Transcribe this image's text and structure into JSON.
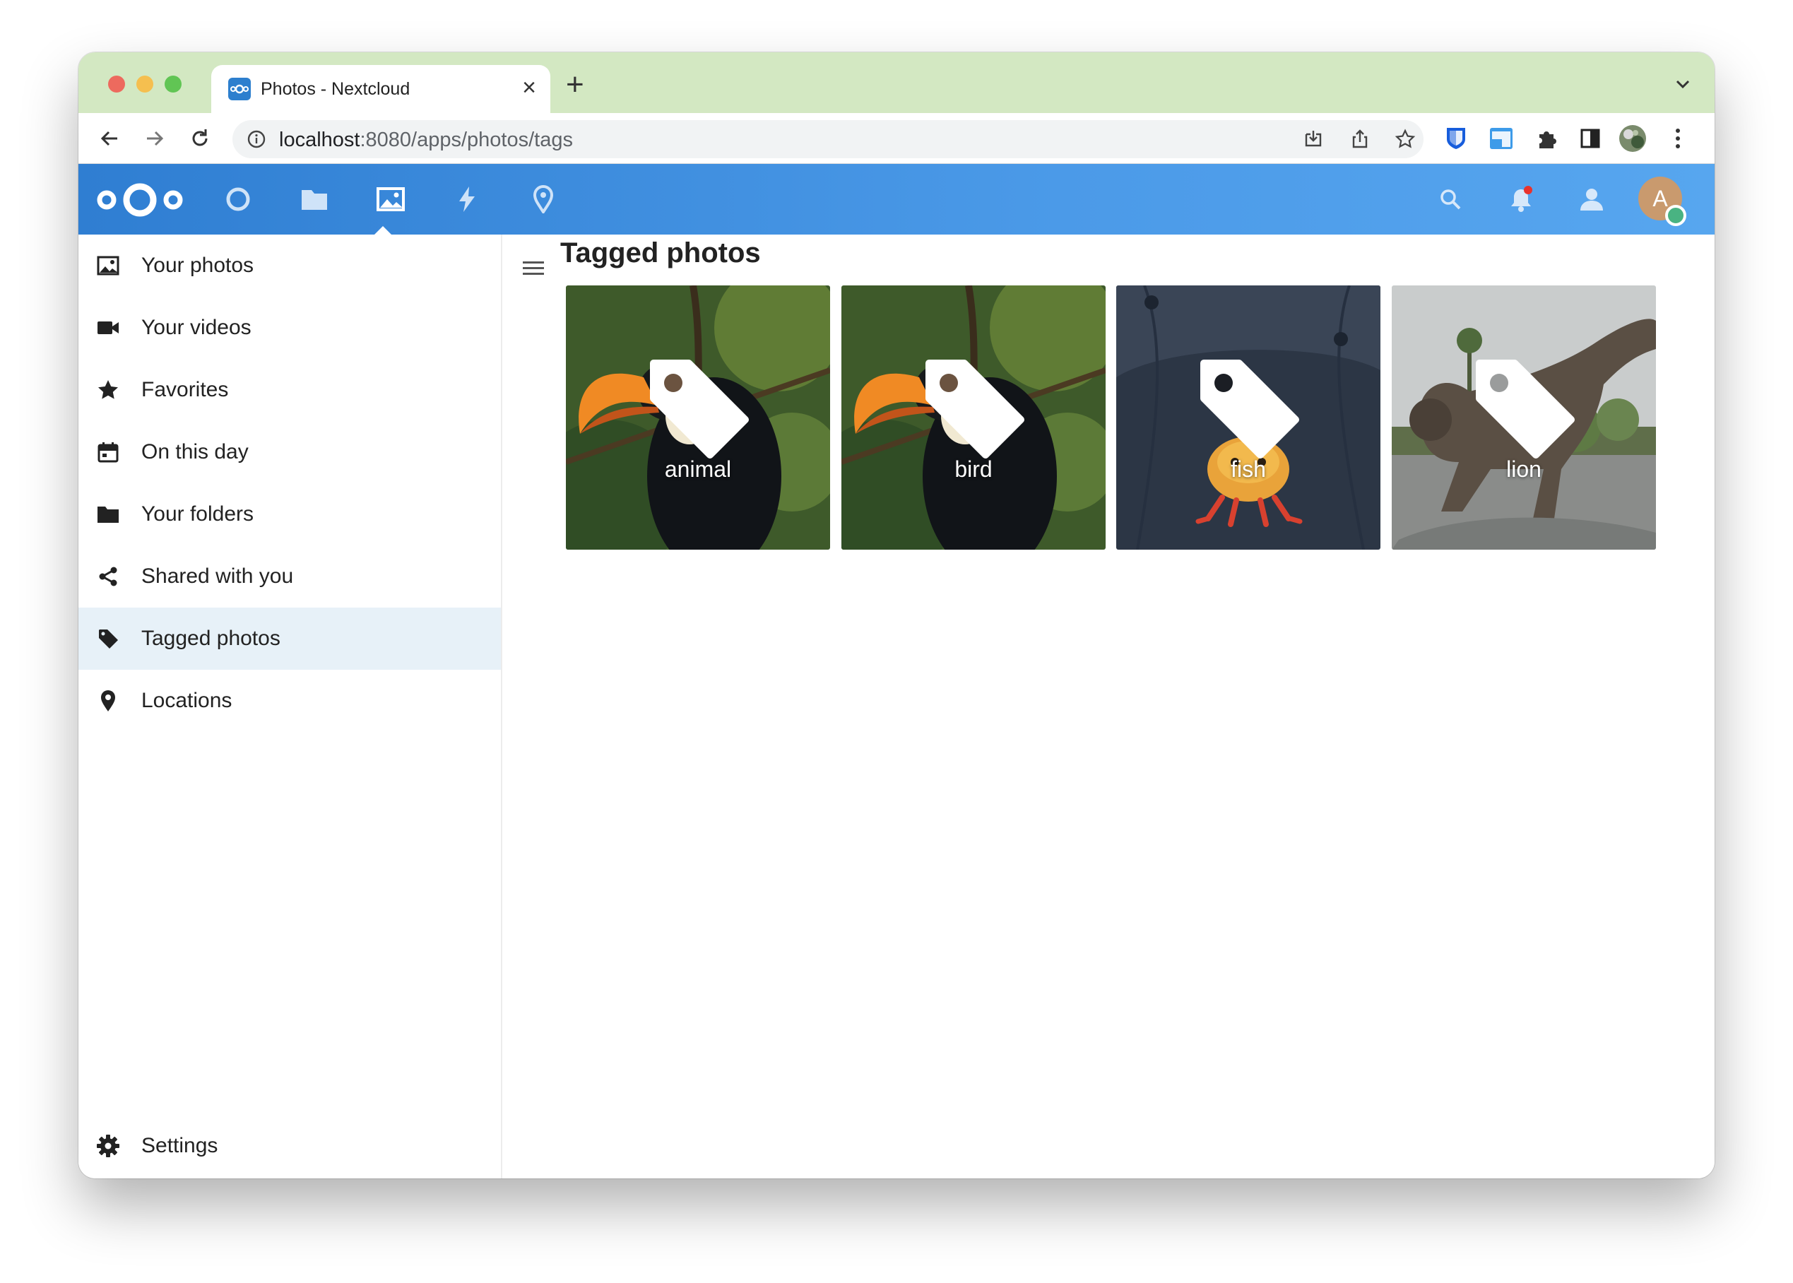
{
  "browser": {
    "tab_title": "Photos - Nextcloud",
    "tab_close": "×",
    "new_tab": "+",
    "url_host": "localhost",
    "url_path": ":8080/apps/photos/tags"
  },
  "header": {
    "apps": [
      "dashboard-icon",
      "files-icon",
      "photos-icon",
      "activity-icon",
      "maps-icon"
    ],
    "active_app": "photos",
    "avatar_initial": "A",
    "colors": {
      "header_start": "#2f7ed2",
      "header_end": "#57a6ef",
      "notification_dot": "#e9322d",
      "status_online": "#49b382"
    }
  },
  "sidebar": {
    "items": [
      {
        "label": "Your photos",
        "icon": "image-icon"
      },
      {
        "label": "Your videos",
        "icon": "video-icon"
      },
      {
        "label": "Favorites",
        "icon": "star-icon"
      },
      {
        "label": "On this day",
        "icon": "calendar-icon"
      },
      {
        "label": "Your folders",
        "icon": "folder-icon"
      },
      {
        "label": "Shared with you",
        "icon": "share-icon"
      },
      {
        "label": "Tagged photos",
        "icon": "tag-icon",
        "active": true
      },
      {
        "label": "Locations",
        "icon": "map-marker-icon"
      }
    ],
    "settings_label": "Settings"
  },
  "main": {
    "title": "Tagged photos",
    "tags": [
      {
        "label": "animal"
      },
      {
        "label": "bird"
      },
      {
        "label": "fish"
      },
      {
        "label": "lion"
      }
    ]
  }
}
